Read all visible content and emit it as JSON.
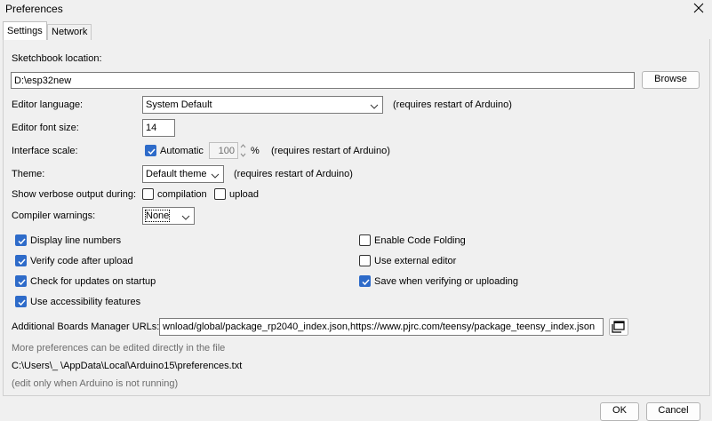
{
  "window": {
    "title": "Preferences"
  },
  "tabs": [
    {
      "label": "Settings"
    },
    {
      "label": "Network"
    }
  ],
  "sketchbook": {
    "label": "Sketchbook location:",
    "value": "D:\\esp32new",
    "browse_label": "Browse"
  },
  "editor_language": {
    "label": "Editor language:",
    "value": "System Default",
    "note": "(requires restart of Arduino)"
  },
  "font_size": {
    "label": "Editor font size:",
    "value": "14"
  },
  "interface_scale": {
    "label": "Interface scale:",
    "automatic_label": "Automatic",
    "value": "100",
    "unit": "%",
    "note": "(requires restart of Arduino)",
    "automatic_checked": true
  },
  "theme": {
    "label": "Theme:",
    "value": "Default theme",
    "note": "(requires restart of Arduino)"
  },
  "verbose": {
    "label": "Show verbose output during:",
    "compilation_label": "compilation",
    "upload_label": "upload",
    "compilation_checked": false,
    "upload_checked": false
  },
  "compiler_warnings": {
    "label": "Compiler warnings:",
    "value": "None"
  },
  "options_left": [
    {
      "label": "Display line numbers",
      "checked": true
    },
    {
      "label": "Verify code after upload",
      "checked": true
    },
    {
      "label": "Check for updates on startup",
      "checked": true
    },
    {
      "label": "Use accessibility features",
      "checked": true
    }
  ],
  "options_right": [
    {
      "label": "Enable Code Folding",
      "checked": false
    },
    {
      "label": "Use external editor",
      "checked": false
    },
    {
      "label": "Save when verifying or uploading",
      "checked": true
    }
  ],
  "boards_urls": {
    "label": "Additional Boards Manager URLs:",
    "value": "wnload/global/package_rp2040_index.json,https://www.pjrc.com/teensy/package_teensy_index.json"
  },
  "footer": {
    "more_prefs": "More preferences can be edited directly in the file",
    "path": "C:\\Users\\_      \\AppData\\Local\\Arduino15\\preferences.txt",
    "edit_note": "(edit only when Arduino is not running)"
  },
  "buttons": {
    "ok_label": "OK",
    "cancel_label": "Cancel"
  },
  "colors": {
    "accent": "#2e6bc9",
    "background": "#f0f0f0"
  }
}
